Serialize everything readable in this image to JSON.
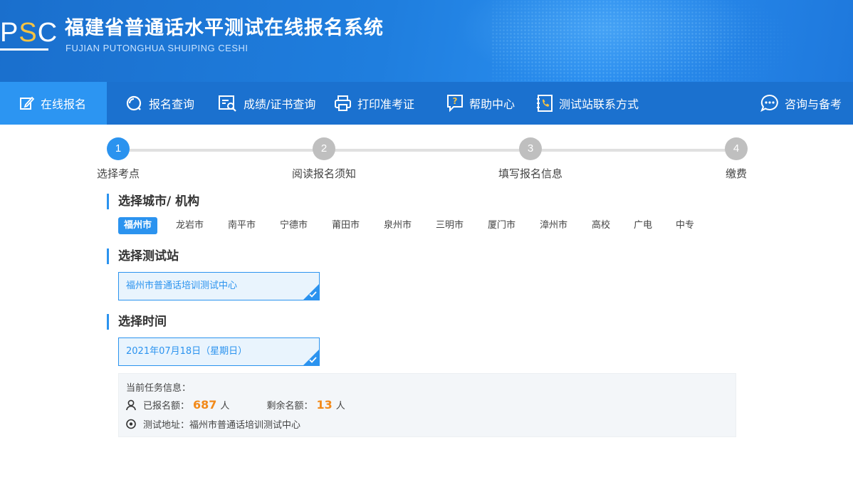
{
  "header": {
    "logo_text": "PSC",
    "title": "福建省普通话水平测试在线报名系统",
    "subtitle": "FUJIAN PUTONGHUA SHUIPING CESHI"
  },
  "nav": {
    "items": [
      {
        "label": "在线报名",
        "icon": "edit-icon"
      },
      {
        "label": "报名查询",
        "icon": "search-icon"
      },
      {
        "label": "成绩/证书查询",
        "icon": "certificate-search-icon"
      },
      {
        "label": "打印准考证",
        "icon": "printer-icon"
      },
      {
        "label": "帮助中心",
        "icon": "help-icon"
      },
      {
        "label": "测试站联系方式",
        "icon": "phone-book-icon"
      },
      {
        "label": "咨询与备考",
        "icon": "chat-icon"
      }
    ]
  },
  "steps": [
    {
      "num": "1",
      "label": "选择考点"
    },
    {
      "num": "2",
      "label": "阅读报名须知"
    },
    {
      "num": "3",
      "label": "填写报名信息"
    },
    {
      "num": "4",
      "label": "缴费"
    }
  ],
  "section_city": {
    "title": "选择城市/ 机构",
    "cities": [
      "福州市",
      "龙岩市",
      "南平市",
      "宁德市",
      "莆田市",
      "泉州市",
      "三明市",
      "厦门市",
      "漳州市",
      "高校",
      "广电",
      "中专"
    ],
    "selected": "福州市"
  },
  "section_station": {
    "title": "选择测试站",
    "selected": "福州市普通话培训测试中心"
  },
  "section_time": {
    "title": "选择时间",
    "selected": "2021年07月18日（星期日）"
  },
  "task_info": {
    "heading": "当前任务信息：",
    "registered_label": "已报名额：",
    "registered_value": "687",
    "registered_unit": "人",
    "remaining_label": "剩余名额：",
    "remaining_value": "13",
    "remaining_unit": "人",
    "address_label": "测试地址：",
    "address_value": "福州市普通话培训测试中心"
  },
  "colors": {
    "primary": "#2b93ef",
    "nav_bg": "#1b71cf",
    "highlight_number": "#f28a1a"
  }
}
